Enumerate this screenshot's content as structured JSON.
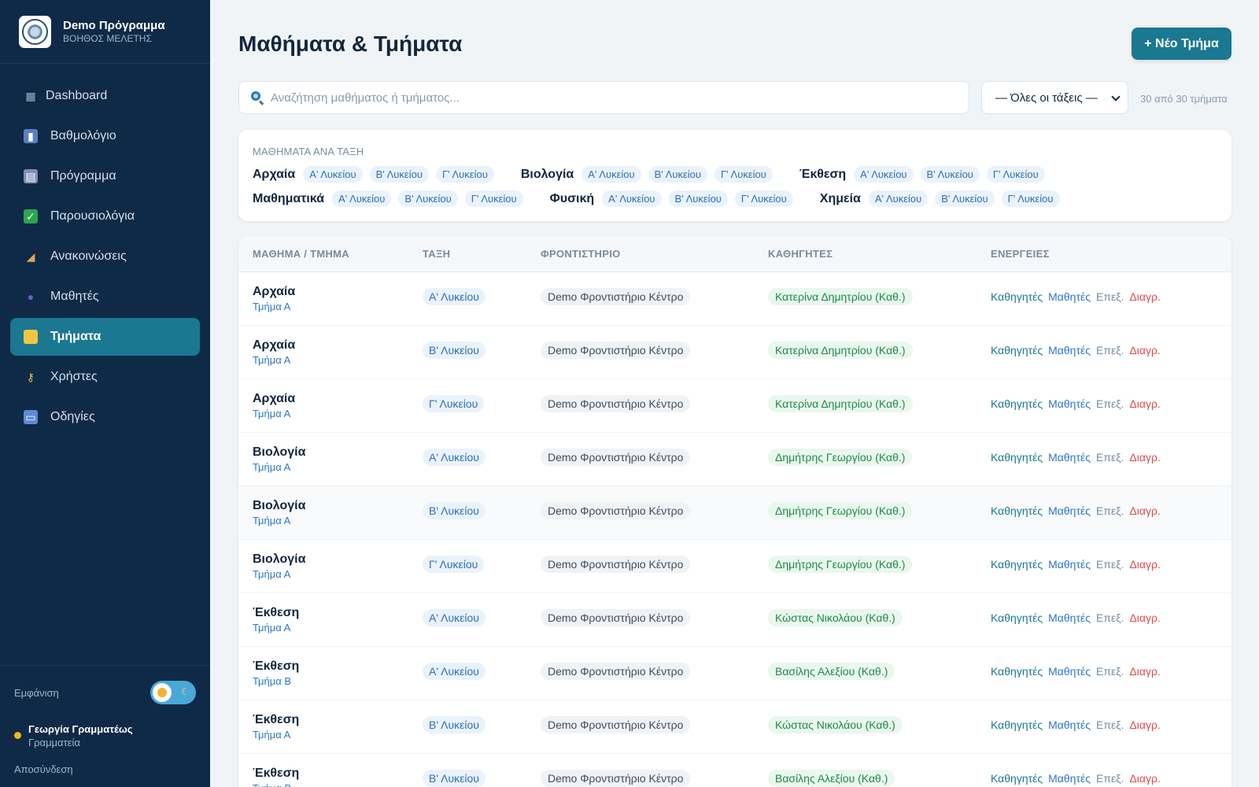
{
  "brand": {
    "title": "Demo Πρόγραμμα",
    "subtitle": "ΒΟΗΘΟΣ ΜΕΛΕΤΗΣ"
  },
  "nav": [
    {
      "label": "Dashboard",
      "icon": "grid-icon",
      "active": false
    },
    {
      "label": "Βαθμολόγιο",
      "icon": "bar-chart-icon",
      "active": false
    },
    {
      "label": "Πρόγραμμα",
      "icon": "calendar-icon",
      "active": false
    },
    {
      "label": "Παρουσιολόγια",
      "icon": "checkbox-icon",
      "active": false
    },
    {
      "label": "Ανακοινώσεις",
      "icon": "megaphone-icon",
      "active": false
    },
    {
      "label": "Μαθητές",
      "icon": "users-icon",
      "active": false
    },
    {
      "label": "Τμήματα",
      "icon": "folder-icon",
      "active": true
    },
    {
      "label": "Χρήστες",
      "icon": "key-icon",
      "active": false
    },
    {
      "label": "Οδηγίες",
      "icon": "book-icon",
      "active": false
    }
  ],
  "appearance_label": "Εμφάνιση",
  "user": {
    "name": "Γεωργία Γραμματέως",
    "role": "Γραμματεία"
  },
  "logout_label": "Αποσύνδεση",
  "page_title": "Μαθήματα & Τμήματα",
  "new_button_label": "+ Νέο Τμήμα",
  "search": {
    "placeholder": "Αναζήτηση μαθήματος ή τμήματος...",
    "value": ""
  },
  "class_filter": {
    "selected": "— Όλες οι τάξεις —"
  },
  "count_text": "30 από 30 τμήματα",
  "subjects_heading": "ΜΑΘΗΜΑΤΑ ΑΝΑ ΤΑΞΗ",
  "subject_lines": [
    [
      {
        "name": "Αρχαία",
        "classes": [
          "Α' Λυκείου",
          "Β' Λυκείου",
          "Γ' Λυκείου"
        ]
      },
      {
        "name": "Βιολογία",
        "classes": [
          "Α' Λυκείου",
          "Β' Λυκείου",
          "Γ' Λυκείου"
        ]
      },
      {
        "name": "Έκθεση",
        "classes": [
          "Α' Λυκείου",
          "Β' Λυκείου",
          "Γ' Λυκείου"
        ]
      }
    ],
    [
      {
        "name": "Μαθηματικά",
        "classes": [
          "Α' Λυκείου",
          "Β' Λυκείου",
          "Γ' Λυκείου"
        ]
      },
      {
        "name": "Φυσική",
        "classes": [
          "Α' Λυκείου",
          "Β' Λυκείου",
          "Γ' Λυκείου"
        ]
      },
      {
        "name": "Χημεία",
        "classes": [
          "Α' Λυκείου",
          "Β' Λυκείου",
          "Γ' Λυκείου"
        ]
      }
    ]
  ],
  "table": {
    "headers": [
      "ΜΑΘΗΜΑ / ΤΜΗΜΑ",
      "ΤΑΞΗ",
      "ΦΡΟΝΤΙΣΤΗΡΙΟ",
      "ΚΑΘΗΓΗΤΕΣ",
      "ΕΝΕΡΓΕΙΕΣ"
    ],
    "action_labels": {
      "teachers": "Καθηγητές",
      "students": "Μαθητές",
      "edit": "Επεξ.",
      "delete": "Διαγρ."
    },
    "rows": [
      {
        "subject": "Αρχαία",
        "dept": "Τμήμα Α",
        "class": "Α' Λυκείου",
        "center": "Demo Φροντιστήριο Κέντρο",
        "teacher": "Κατερίνα Δημητρίου (Καθ.)"
      },
      {
        "subject": "Αρχαία",
        "dept": "Τμήμα Α",
        "class": "Β' Λυκείου",
        "center": "Demo Φροντιστήριο Κέντρο",
        "teacher": "Κατερίνα Δημητρίου (Καθ.)"
      },
      {
        "subject": "Αρχαία",
        "dept": "Τμήμα Α",
        "class": "Γ' Λυκείου",
        "center": "Demo Φροντιστήριο Κέντρο",
        "teacher": "Κατερίνα Δημητρίου (Καθ.)"
      },
      {
        "subject": "Βιολογία",
        "dept": "Τμήμα Α",
        "class": "Α' Λυκείου",
        "center": "Demo Φροντιστήριο Κέντρο",
        "teacher": "Δημήτρης Γεωργίου (Καθ.)"
      },
      {
        "subject": "Βιολογία",
        "dept": "Τμήμα Α",
        "class": "Β' Λυκείου",
        "center": "Demo Φροντιστήριο Κέντρο",
        "teacher": "Δημήτρης Γεωργίου (Καθ.)"
      },
      {
        "subject": "Βιολογία",
        "dept": "Τμήμα Α",
        "class": "Γ' Λυκείου",
        "center": "Demo Φροντιστήριο Κέντρο",
        "teacher": "Δημήτρης Γεωργίου (Καθ.)"
      },
      {
        "subject": "Έκθεση",
        "dept": "Τμήμα Α",
        "class": "Α' Λυκείου",
        "center": "Demo Φροντιστήριο Κέντρο",
        "teacher": "Κώστας Νικολάου (Καθ.)"
      },
      {
        "subject": "Έκθεση",
        "dept": "Τμήμα Β",
        "class": "Α' Λυκείου",
        "center": "Demo Φροντιστήριο Κέντρο",
        "teacher": "Βασίλης Αλεξίου (Καθ.)"
      },
      {
        "subject": "Έκθεση",
        "dept": "Τμήμα Α",
        "class": "Β' Λυκείου",
        "center": "Demo Φροντιστήριο Κέντρο",
        "teacher": "Κώστας Νικολάου (Καθ.)"
      },
      {
        "subject": "Έκθεση",
        "dept": "Τμήμα Β",
        "class": "Β' Λυκείου",
        "center": "Demo Φροντιστήριο Κέντρο",
        "teacher": "Βασίλης Αλεξίου (Καθ.)"
      }
    ]
  },
  "colors": {
    "sidebar_bg": "#0f2a47",
    "accent": "#1a7891",
    "page_bg": "#f1f4f7",
    "delete": "#e2494b",
    "teacher_pill": "#1f8a48"
  }
}
